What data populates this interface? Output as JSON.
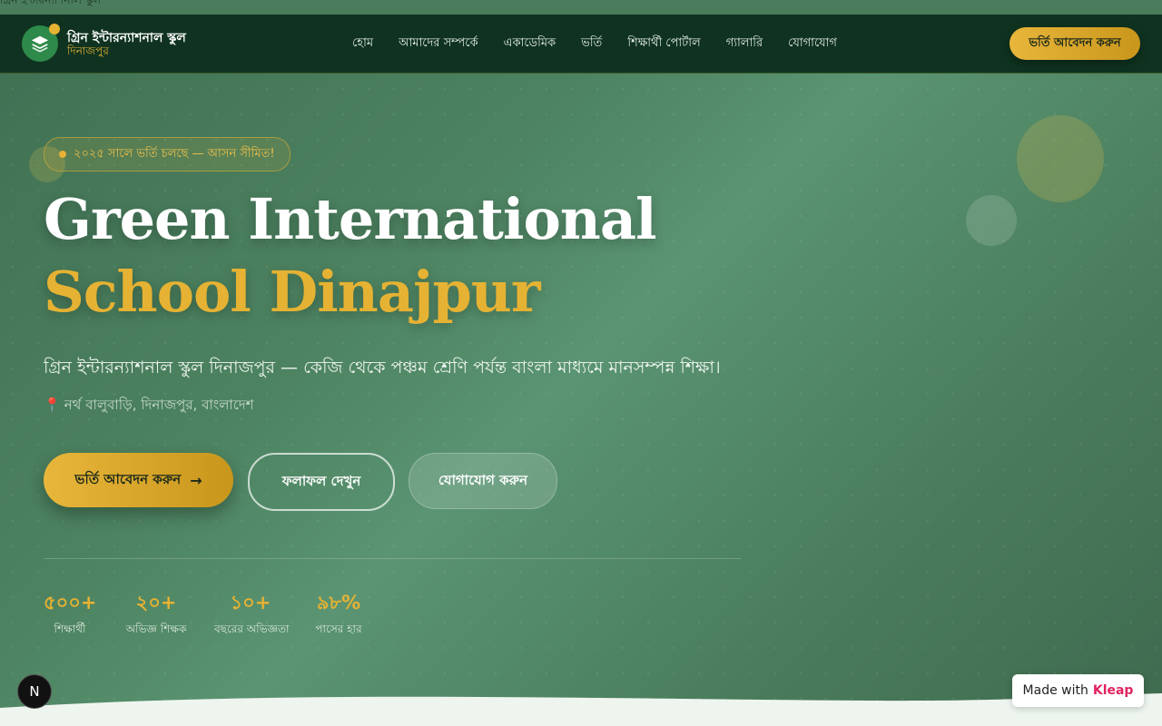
{
  "top_strip": {
    "text": "গ্রিন ইন্টারন্যাশনাল স্কুল"
  },
  "navbar": {
    "brand_name": "গ্রিন ইন্টারন্যাশনাল স্কুল",
    "brand_sub": "দিনাজপুর",
    "links": [
      "হোম",
      "আমাদের সম্পর্কে",
      "একাডেমিক",
      "ভর্তি",
      "শিক্ষার্থী পোর্টাল",
      "গ্যালারি",
      "যোগাযোগ"
    ],
    "cta_label": "ভর্তি আবেদন করুন"
  },
  "hero": {
    "badge": "২০২৫ সালে ভর্তি চলছে — আসন সীমিত!",
    "title_line1": "Green International",
    "title_line2": "School Dinajpur",
    "tagline": "গ্রিন ইন্টারন্যাশনাল স্কুল দিনাজপুর — কেজি থেকে পঞ্চম শ্রেণি পর্যন্ত বাংলা মাধ্যমে মানসম্পন্ন শিক্ষা।",
    "location": "নর্থ বালুবাড়ি, দিনাজপুর, বাংলাদেশ",
    "buttons": {
      "apply": "ভর্তি আবেদন করুন",
      "results": "ফলাফল দেখুন",
      "contact": "যোগাযোগ করুন"
    }
  },
  "stats": [
    {
      "value": "৫০০+",
      "label": "শিক্ষার্থী"
    },
    {
      "value": "২০+",
      "label": "অভিজ্ঞ শিক্ষক"
    },
    {
      "value": "১০+",
      "label": "বছরের অভিজ্ঞতা"
    },
    {
      "value": "৯৮%",
      "label": "পাসের হার"
    }
  ],
  "footer_badges": {
    "next_icon_letter": "N",
    "made_with": "Made with",
    "made_with_brand": "Kleap"
  },
  "colors": {
    "accent_gold": "#e6b233",
    "navbar_bg": "#0f3320",
    "hero_green": "#4d8361"
  }
}
